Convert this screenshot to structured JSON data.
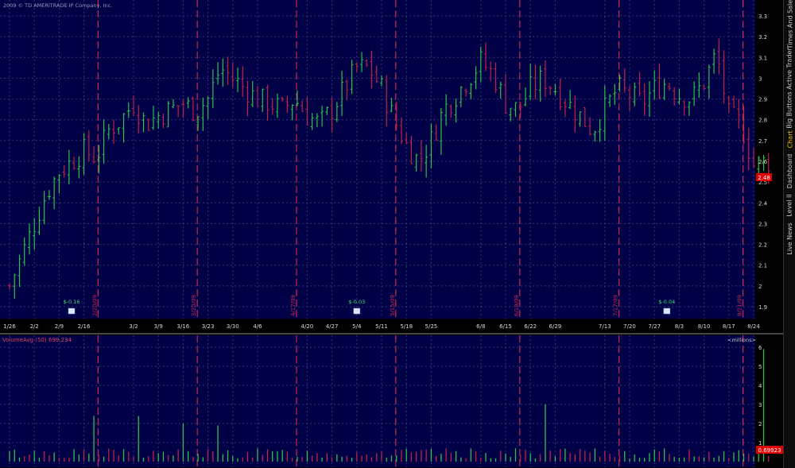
{
  "copyright": "2009 © TD AMERITRADE IP Company, Inc.",
  "colors": {
    "background": "#000046",
    "grid": "#35357a",
    "up": "#2cc24a",
    "down": "#c0204a",
    "event_line": "#c82850",
    "axis_text": "#d8d8d8",
    "price_badge": "#e00000"
  },
  "price_panel": {
    "last_price_label": "2.48",
    "y_ticks": [
      "1.9",
      "2",
      "2.1",
      "2.2",
      "2.3",
      "2.4",
      "2.5",
      "2.6",
      "2.7",
      "2.8",
      "2.9",
      "3",
      "3.1",
      "3.2",
      "3.3"
    ],
    "x_ticks": [
      "1/26",
      "2/2",
      "2/9",
      "2/16",
      "3/2",
      "3/9",
      "3/16",
      "3/23",
      "3/30",
      "4/6",
      "4/20",
      "4/27",
      "5/4",
      "5/11",
      "5/18",
      "5/25",
      "6/8",
      "6/15",
      "6/22",
      "6/29",
      "7/13",
      "7/20",
      "7/27",
      "8/3",
      "8/10",
      "8/17",
      "8/24"
    ],
    "event_lines": [
      {
        "label": "2/20/09",
        "week": 3.57
      },
      {
        "label": "3/20/09",
        "week": 7.57
      },
      {
        "label": "4/17/09",
        "week": 11.57
      },
      {
        "label": "5/15/09",
        "week": 15.57
      },
      {
        "label": "6/19/09",
        "week": 20.57
      },
      {
        "label": "7/17/09",
        "week": 24.57
      },
      {
        "label": "8/21/09",
        "week": 29.57
      }
    ],
    "dividends": [
      {
        "label": "$-0.16",
        "week": 2.5
      },
      {
        "label": "$-0.03",
        "week": 14.0
      },
      {
        "label": "$-0.04",
        "week": 26.5
      }
    ]
  },
  "volume_panel": {
    "study_name": "VolumeAvg (50)",
    "study_value": "699,234",
    "units": "<millions>",
    "avg_label": "0.69923",
    "y_ticks": [
      "1",
      "2",
      "3",
      "4",
      "5",
      "6"
    ]
  },
  "sidebar_tabs": [
    "Times And Sales",
    "Active Trader",
    "Big Buttons",
    "Chart",
    "Dashboard",
    "Level II",
    "Live News"
  ],
  "active_tab": "Chart",
  "chart_data": {
    "type": "ohlc",
    "x_axis": "week of 2009",
    "x_ticks": [
      "1/26",
      "2/2",
      "2/9",
      "2/16",
      "3/2",
      "3/9",
      "3/16",
      "3/23",
      "3/30",
      "4/6",
      "4/20",
      "4/27",
      "5/4",
      "5/11",
      "5/18",
      "5/25",
      "6/8",
      "6/15",
      "6/22",
      "6/29",
      "7/13",
      "7/20",
      "7/27",
      "8/3",
      "8/10",
      "8/17",
      "8/24"
    ],
    "x_tick_weeks": [
      0,
      1,
      2,
      3,
      5,
      6,
      7,
      8,
      9,
      10,
      12,
      13,
      14,
      15,
      16,
      17,
      19,
      20,
      21,
      22,
      24,
      25,
      26,
      27,
      28,
      29,
      30
    ],
    "ylim": [
      1.85,
      3.35
    ],
    "close_path": [
      {
        "week": 0,
        "close": 2.0
      },
      {
        "week": 0.5,
        "close": 2.15
      },
      {
        "week": 1,
        "close": 2.3
      },
      {
        "week": 1.5,
        "close": 2.45
      },
      {
        "week": 2,
        "close": 2.55
      },
      {
        "week": 2.5,
        "close": 2.6
      },
      {
        "week": 3,
        "close": 2.65
      },
      {
        "week": 3.5,
        "close": 2.62
      },
      {
        "week": 4,
        "close": 2.75
      },
      {
        "week": 4.5,
        "close": 2.8
      },
      {
        "week": 5,
        "close": 2.88
      },
      {
        "week": 5.5,
        "close": 2.78
      },
      {
        "week": 6,
        "close": 2.82
      },
      {
        "week": 6.5,
        "close": 2.85
      },
      {
        "week": 7,
        "close": 2.88
      },
      {
        "week": 7.5,
        "close": 2.84
      },
      {
        "week": 8,
        "close": 2.9
      },
      {
        "week": 8.5,
        "close": 3.05
      },
      {
        "week": 9,
        "close": 3.0
      },
      {
        "week": 9.5,
        "close": 2.95
      },
      {
        "week": 10,
        "close": 2.9
      },
      {
        "week": 10.5,
        "close": 2.88
      },
      {
        "week": 11,
        "close": 2.85
      },
      {
        "week": 11.5,
        "close": 2.9
      },
      {
        "week": 12,
        "close": 2.82
      },
      {
        "week": 12.5,
        "close": 2.78
      },
      {
        "week": 13,
        "close": 2.85
      },
      {
        "week": 13.5,
        "close": 2.95
      },
      {
        "week": 14,
        "close": 3.05
      },
      {
        "week": 14.5,
        "close": 3.05
      },
      {
        "week": 15,
        "close": 2.95
      },
      {
        "week": 15.5,
        "close": 2.8
      },
      {
        "week": 16,
        "close": 2.68
      },
      {
        "week": 16.5,
        "close": 2.6
      },
      {
        "week": 17,
        "close": 2.7
      },
      {
        "week": 17.5,
        "close": 2.85
      },
      {
        "week": 18,
        "close": 2.92
      },
      {
        "week": 18.5,
        "close": 3.0
      },
      {
        "week": 19,
        "close": 3.08
      },
      {
        "week": 19.5,
        "close": 3.02
      },
      {
        "week": 20,
        "close": 2.88
      },
      {
        "week": 20.5,
        "close": 2.85
      },
      {
        "week": 21,
        "close": 2.95
      },
      {
        "week": 21.5,
        "close": 3.0
      },
      {
        "week": 22,
        "close": 2.95
      },
      {
        "week": 22.5,
        "close": 2.88
      },
      {
        "week": 23,
        "close": 2.82
      },
      {
        "week": 23.5,
        "close": 2.75
      },
      {
        "week": 24,
        "close": 2.85
      },
      {
        "week": 24.5,
        "close": 2.95
      },
      {
        "week": 25,
        "close": 2.92
      },
      {
        "week": 25.5,
        "close": 2.88
      },
      {
        "week": 26,
        "close": 2.95
      },
      {
        "week": 26.5,
        "close": 2.98
      },
      {
        "week": 27,
        "close": 2.92
      },
      {
        "week": 27.5,
        "close": 2.9
      },
      {
        "week": 28,
        "close": 2.98
      },
      {
        "week": 28.5,
        "close": 3.12
      },
      {
        "week": 29,
        "close": 2.82
      },
      {
        "week": 29.5,
        "close": 2.78
      },
      {
        "week": 30,
        "close": 2.58
      },
      {
        "week": 30.5,
        "close": 2.6
      }
    ],
    "volume_ylim": [
      0,
      6.4
    ],
    "volume_spikes_millions": [
      {
        "week": 3.4,
        "value": 2.4
      },
      {
        "week": 5.2,
        "value": 2.4
      },
      {
        "week": 7.0,
        "value": 2.0
      },
      {
        "week": 8.5,
        "value": 1.9
      },
      {
        "week": 21.6,
        "value": 3.0
      },
      {
        "week": 30.3,
        "value": 5.9
      }
    ]
  }
}
